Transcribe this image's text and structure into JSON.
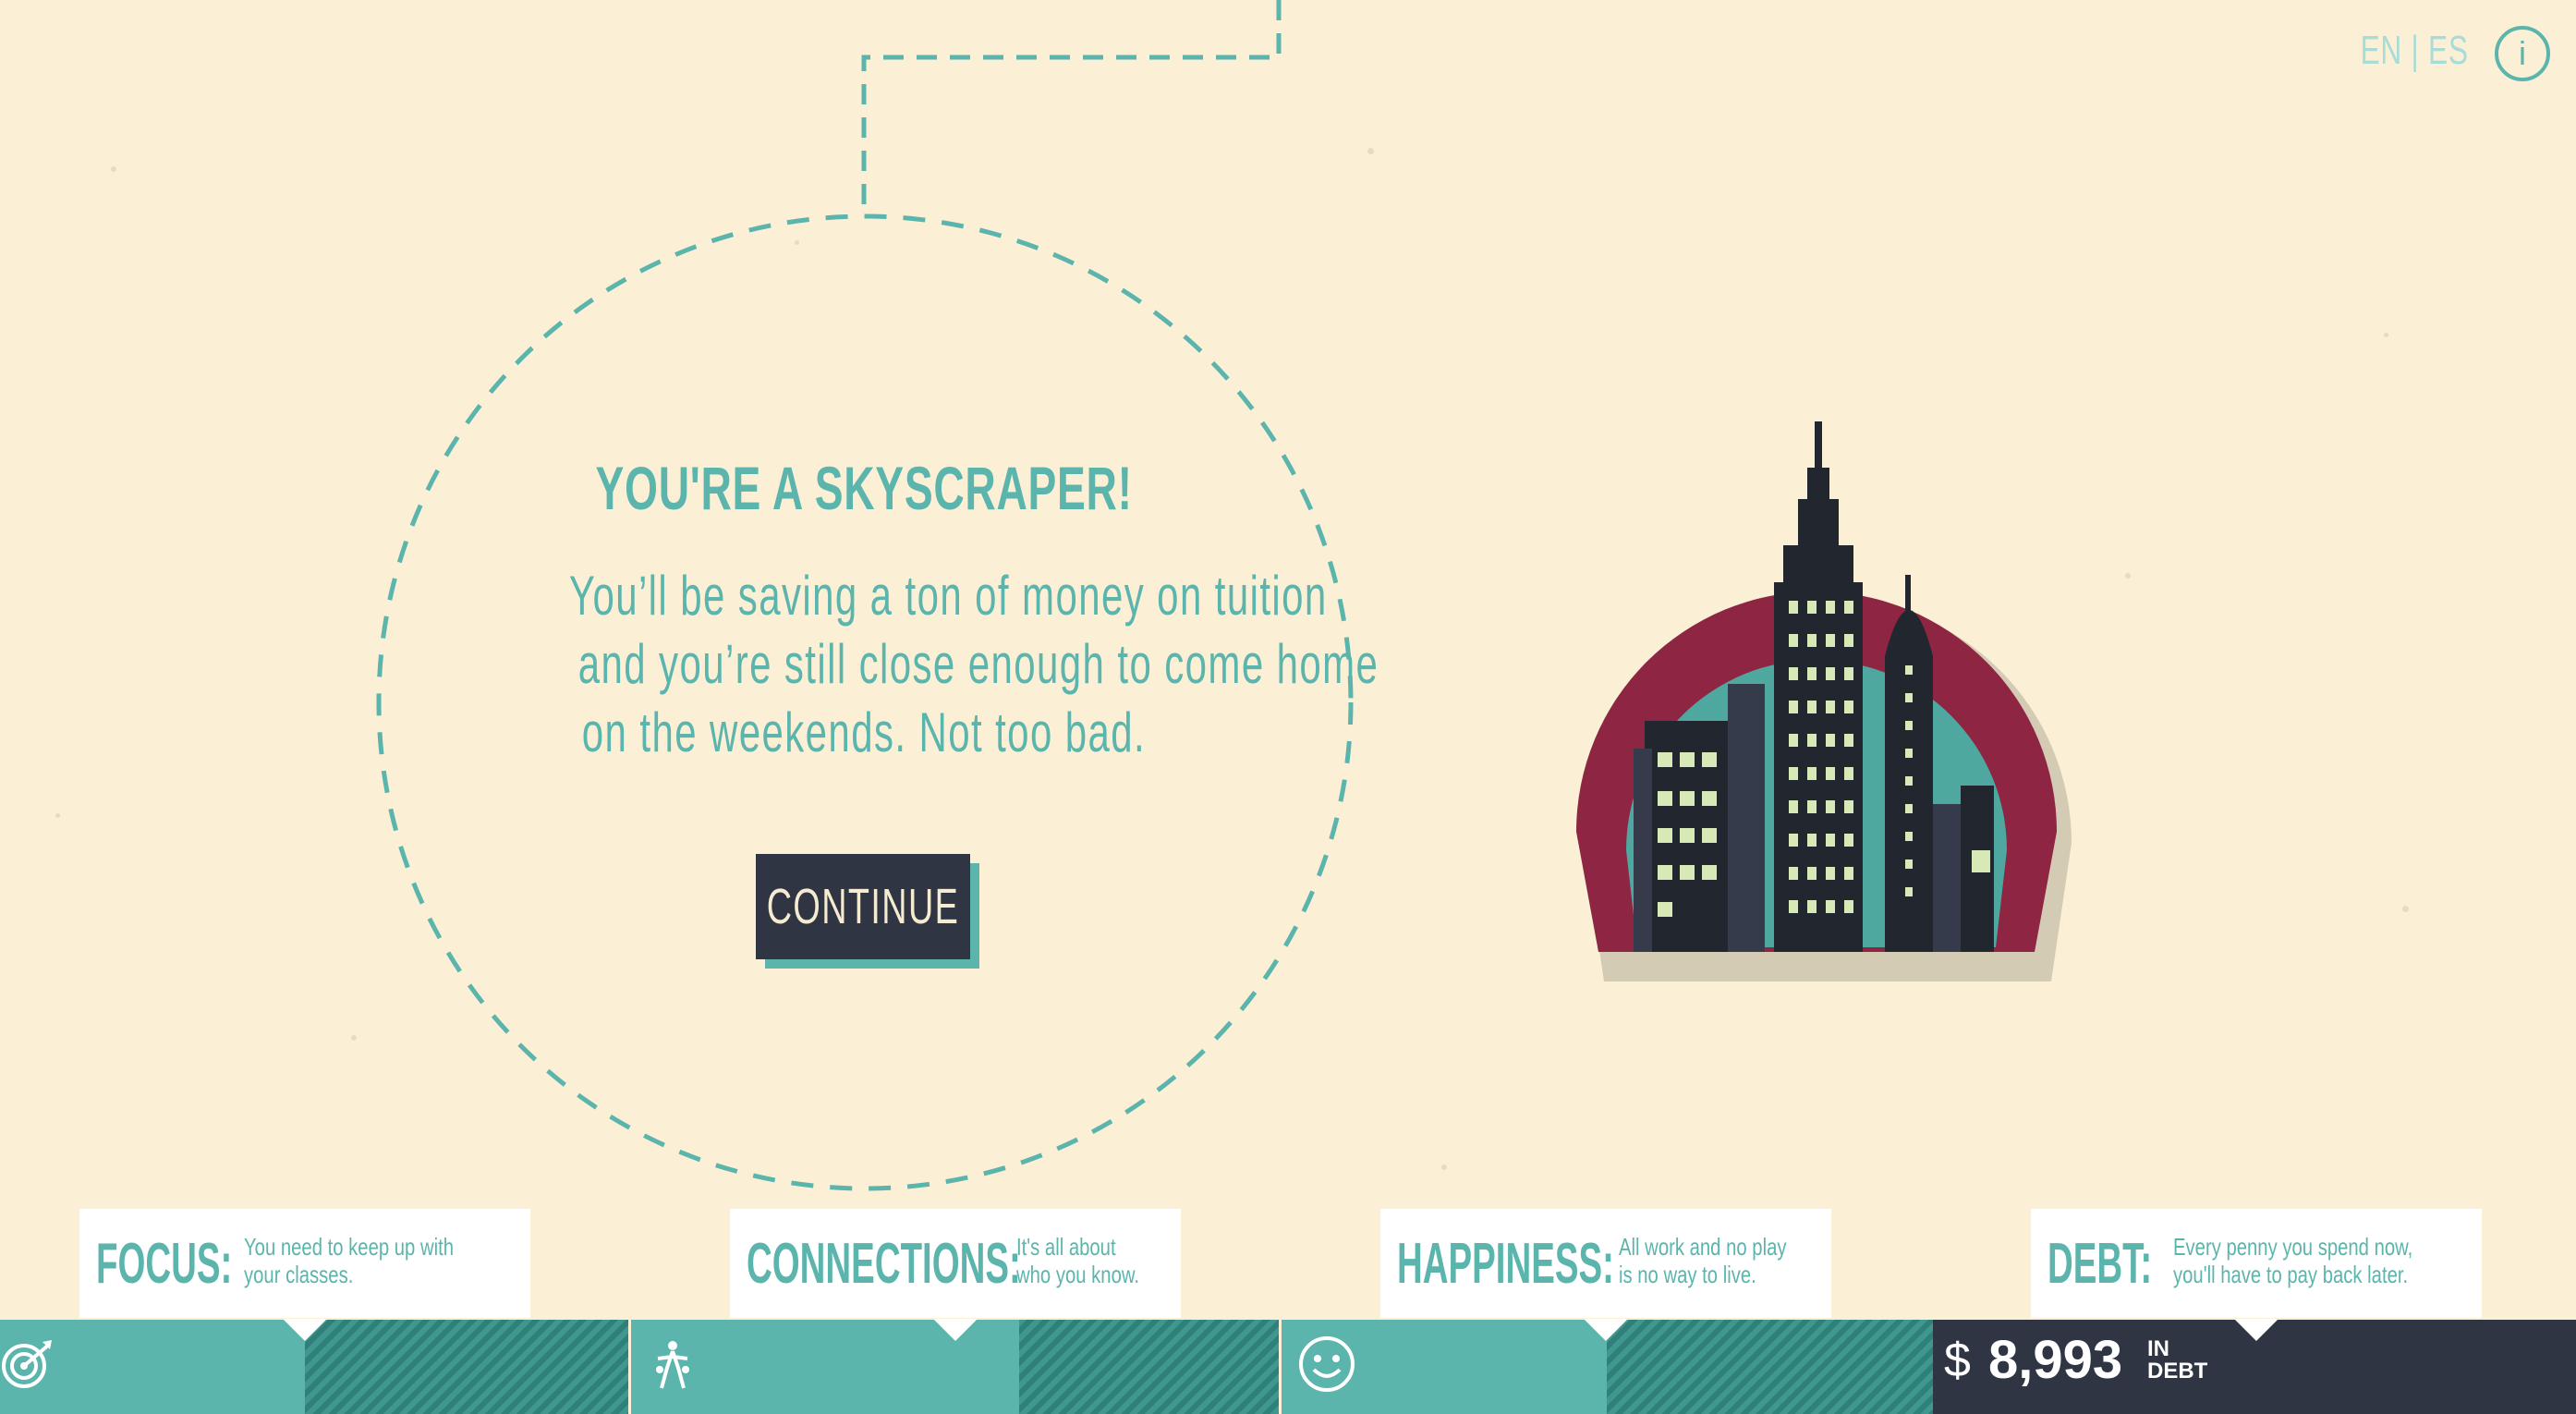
{
  "header": {
    "lang_en": "EN",
    "lang_sep": "|",
    "lang_es": "ES",
    "info_glyph": "i"
  },
  "result": {
    "title": "YOU'RE A SKYSCRAPER!",
    "body_line1": "You’ll be saving a ton of money on tuition",
    "body_line2": "and you’re still close enough to come home",
    "body_line3": "on the weekends. Not too bad.",
    "continue_label": "CONTINUE",
    "illustration_icon": "skyscraper-city-badge"
  },
  "cards": [
    {
      "label": "FOCUS:",
      "line1": "You need to keep up with",
      "line2": "your classes.",
      "icon": "target-icon"
    },
    {
      "label": "CONNECTIONS:",
      "line1": "It's all about",
      "line2": "who you know.",
      "icon": "people-icon"
    },
    {
      "label": "HAPPINESS:",
      "line1": "All work and no play",
      "line2": "is no way to live.",
      "icon": "smiley-icon"
    },
    {
      "label": "DEBT:",
      "line1": "Every penny you spend now,",
      "line2": "you'll have to pay back later.",
      "icon": "dollar-icon"
    }
  ],
  "debt": {
    "symbol": "$",
    "amount": "8,993",
    "in_label": "IN",
    "debt_label": "DEBT"
  },
  "colors": {
    "background": "#fbf0d5",
    "teal": "#5bb5ad",
    "dark": "#2f3543",
    "maroon": "#8d2543"
  }
}
